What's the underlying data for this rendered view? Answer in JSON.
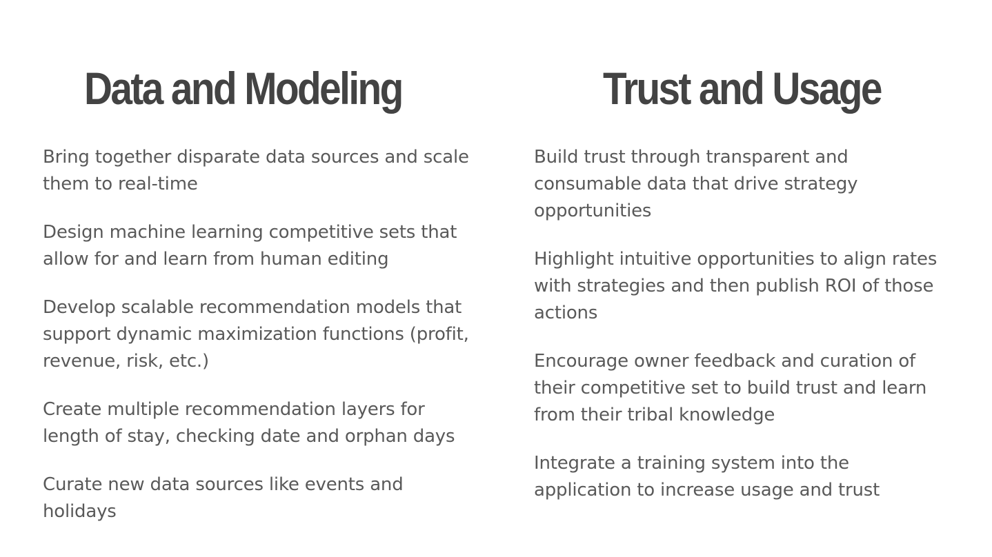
{
  "columns": [
    {
      "title": "Data and Modeling",
      "items": [
        "Bring together disparate data sources and scale them to real-time",
        "Design machine learning competitive sets that allow for and learn from human editing",
        "Develop scalable recommendation models that support dynamic maximization functions (profit, revenue, risk, etc.)",
        "Create multiple recommendation layers for length of stay, checking date and orphan days",
        "Curate new data sources like events and holidays"
      ]
    },
    {
      "title": "Trust and Usage",
      "items": [
        "Build trust through transparent and consumable data that drive strategy opportunities",
        "Highlight intuitive opportunities to align rates with strategies and then publish ROI of those actions",
        "Encourage owner feedback and curation of their competitive set to build trust and learn from their tribal knowledge",
        "Integrate a training system into the application to increase usage and trust"
      ]
    }
  ]
}
